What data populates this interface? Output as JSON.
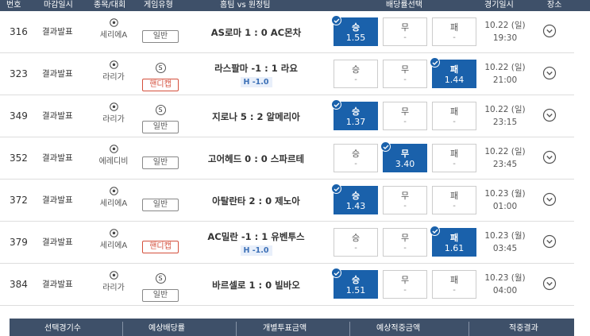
{
  "header": {
    "no": "번호",
    "deadline": "마감일시",
    "league": "종목/대회",
    "game_type": "게임유형",
    "match": "홈팀 vs 원정팀",
    "odds_select": "배당률선택",
    "match_time": "경기일시",
    "venue": "장소"
  },
  "rows": [
    {
      "no": "316",
      "deadline": "결과발표",
      "league": "세리에A",
      "types": [
        "일반"
      ],
      "match": "AS로마 1 : 0 AC몬차",
      "handicap": "",
      "win_label": "승",
      "win_odds": "1.55",
      "draw_label": "무",
      "draw_odds": "-",
      "lose_label": "패",
      "lose_odds": "-",
      "selected": "win",
      "date": "10.22 (일)",
      "time": "19:30"
    },
    {
      "no": "323",
      "deadline": "결과발표",
      "league": "라리가",
      "types": [
        "S",
        "핸디캡"
      ],
      "match": "라스팔마 -1 : 1 라요",
      "handicap": "H -1.0",
      "win_label": "승",
      "win_odds": "-",
      "draw_label": "무",
      "draw_odds": "-",
      "lose_label": "패",
      "lose_odds": "1.44",
      "selected": "lose",
      "date": "10.22 (일)",
      "time": "21:00"
    },
    {
      "no": "349",
      "deadline": "결과발표",
      "league": "라리가",
      "types": [
        "S",
        "일반"
      ],
      "match": "지로나 5 : 2 알메리아",
      "handicap": "",
      "win_label": "승",
      "win_odds": "1.37",
      "draw_label": "무",
      "draw_odds": "-",
      "lose_label": "패",
      "lose_odds": "-",
      "selected": "win",
      "date": "10.22 (일)",
      "time": "23:15"
    },
    {
      "no": "352",
      "deadline": "결과발표",
      "league": "에레디비",
      "types": [
        "일반"
      ],
      "match": "고어헤드 0 : 0 스파르테",
      "handicap": "",
      "win_label": "승",
      "win_odds": "-",
      "draw_label": "무",
      "draw_odds": "3.40",
      "lose_label": "패",
      "lose_odds": "-",
      "selected": "draw",
      "date": "10.22 (일)",
      "time": "23:45"
    },
    {
      "no": "372",
      "deadline": "결과발표",
      "league": "세리에A",
      "types": [
        "일반"
      ],
      "match": "아탈란타 2 : 0 제노아",
      "handicap": "",
      "win_label": "승",
      "win_odds": "1.43",
      "draw_label": "무",
      "draw_odds": "-",
      "lose_label": "패",
      "lose_odds": "-",
      "selected": "win",
      "date": "10.23 (월)",
      "time": "01:00"
    },
    {
      "no": "379",
      "deadline": "결과발표",
      "league": "세리에A",
      "types": [
        "핸디캡"
      ],
      "match": "AC밀란 -1 : 1 유벤투스",
      "handicap": "H -1.0",
      "win_label": "승",
      "win_odds": "-",
      "draw_label": "무",
      "draw_odds": "-",
      "lose_label": "패",
      "lose_odds": "1.61",
      "selected": "lose",
      "date": "10.23 (월)",
      "time": "03:45"
    },
    {
      "no": "384",
      "deadline": "결과발표",
      "league": "라리가",
      "types": [
        "S",
        "일반"
      ],
      "match": "바르셀로 1 : 0 빌바오",
      "handicap": "",
      "win_label": "승",
      "win_odds": "1.51",
      "draw_label": "무",
      "draw_odds": "-",
      "lose_label": "패",
      "lose_odds": "-",
      "selected": "win",
      "date": "10.23 (월)",
      "time": "04:00"
    }
  ],
  "footer": {
    "selected_count": "선택경기수",
    "expected_odds": "예상배당률",
    "stake": "개별투표금액",
    "expected_payout": "예상적중금액",
    "result": "적중결과"
  },
  "icons": {
    "ball": "soccer-ball-icon",
    "place": "chevron-down-circle-icon",
    "check": "check-icon"
  },
  "colors": {
    "header_bg": "#3e5069",
    "selected_odd": "#1a61ab",
    "handicap_tag": "#d44f3c",
    "handicap_line": "#3b6fb6"
  }
}
